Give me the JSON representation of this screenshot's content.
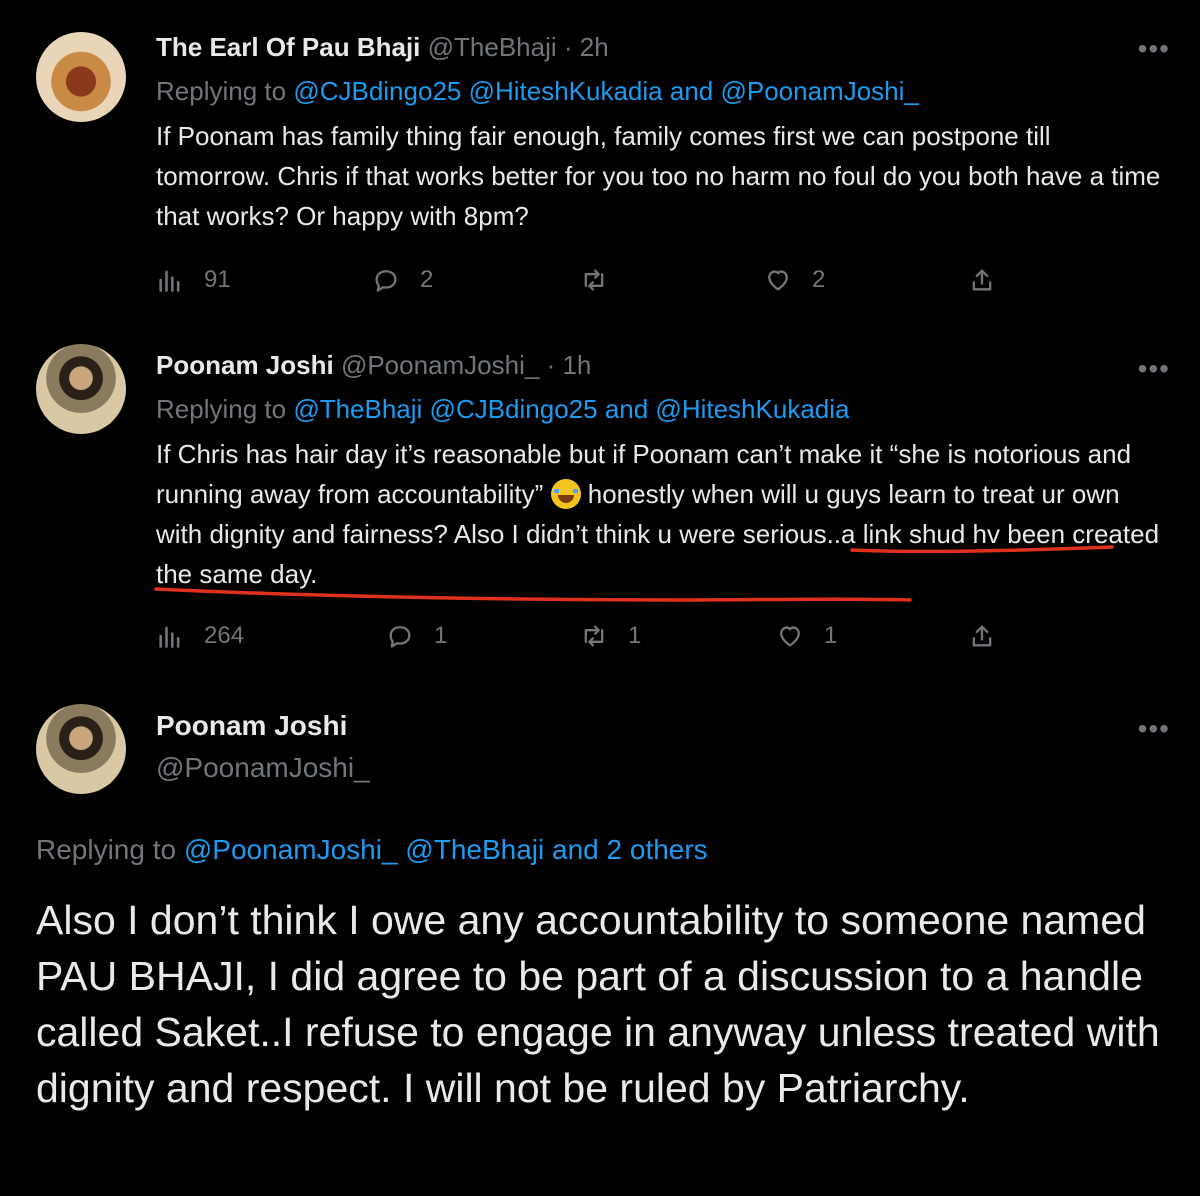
{
  "tweets": [
    {
      "name": "The Earl Of Pau Bhaji",
      "handle": "@TheBhaji",
      "dot": "·",
      "time": "2h",
      "more": "•••",
      "replying_prefix": "Replying to",
      "replying_mentions": "@CJBdingo25 @HiteshKukadia and @PoonamJoshi_",
      "text": "If Poonam has family thing fair enough, family comes first we can postpone till tomorrow. Chris if that works better for you too no harm no foul do you both have a time that works? Or happy with 8pm?",
      "views": "91",
      "replies": "2",
      "retweets": "",
      "likes": "2"
    },
    {
      "name": "Poonam Joshi",
      "handle": "@PoonamJoshi_",
      "dot": "·",
      "time": "1h",
      "more": "•••",
      "replying_prefix": "Replying to",
      "replying_mentions": "@TheBhaji @CJBdingo25 and @HiteshKukadia",
      "text_part1": "If Chris has hair day it’s reasonable but if Poonam can’t make it “she is notorious and running away from accountability” ",
      "text_part2": " honestly when will u guys learn to treat ur own with dignity and fairness? ",
      "text_underlined": "Also I didn’t think u were serious..a link shud hv been created the same day.",
      "views": "264",
      "replies": "1",
      "retweets": "1",
      "likes": "1"
    }
  ],
  "main": {
    "name": "Poonam Joshi",
    "handle": "@PoonamJoshi_",
    "more": "•••",
    "replying_prefix": "Replying to",
    "replying_mentions": "@PoonamJoshi_ @TheBhaji and 2 others",
    "text": "Also I don’t think I owe any accountability to someone named PAU BHAJI, I did agree to be part of a discussion to a handle called Saket..I refuse to engage in anyway unless treated with dignity and respect. I will not be ruled by Patriarchy."
  },
  "colors": {
    "background": "#000000",
    "text": "#e7e9ea",
    "muted": "#71767b",
    "link": "#1d9bf0",
    "annotation": "#e0301e"
  }
}
